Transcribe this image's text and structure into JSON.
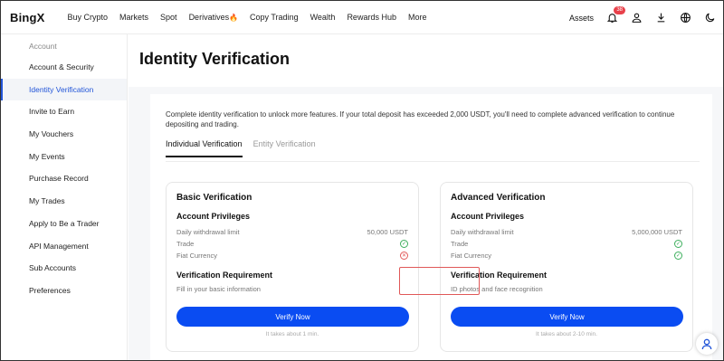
{
  "header": {
    "logo": "BingX",
    "nav": [
      "Buy Crypto",
      "Markets",
      "Spot",
      "Derivatives",
      "Copy Trading",
      "Wealth",
      "Rewards Hub",
      "More"
    ],
    "assets": "Assets",
    "notification_count": "38"
  },
  "sidebar": {
    "heading": "Account",
    "items": [
      {
        "label": "Account & Security"
      },
      {
        "label": "Identity Verification"
      },
      {
        "label": "Invite to Earn"
      },
      {
        "label": "My Vouchers"
      },
      {
        "label": "My Events"
      },
      {
        "label": "Purchase Record"
      },
      {
        "label": "My Trades"
      },
      {
        "label": "Apply to Be a Trader"
      },
      {
        "label": "API Management"
      },
      {
        "label": "Sub Accounts"
      },
      {
        "label": "Preferences"
      }
    ]
  },
  "main": {
    "title": "Identity Verification",
    "notice": "Complete identity verification to unlock more features. If your total deposit has exceeded 2,000 USDT, you'll need to complete advanced verification to continue depositing and trading.",
    "tabs": [
      {
        "label": "Individual Verification"
      },
      {
        "label": "Entity Verification"
      }
    ],
    "basic": {
      "title": "Basic Verification",
      "privileges_title": "Account Privileges",
      "withdrawal_label": "Daily withdrawal limit",
      "withdrawal_value": "50,000 USDT",
      "trade_label": "Trade",
      "fiat_label": "Fiat Currency",
      "req_title": "Verification Requirement",
      "req_text": "Fill in your basic information",
      "button": "Verify Now",
      "takes": "It takes about 1 min."
    },
    "advanced": {
      "title": "Advanced Verification",
      "privileges_title": "Account Privileges",
      "withdrawal_label": "Daily withdrawal limit",
      "withdrawal_value": "5,000,000 USDT",
      "trade_label": "Trade",
      "fiat_label": "Fiat Currency",
      "req_title": "Verification Requirement",
      "req_text": "ID photos and face recognition",
      "button": "Verify Now",
      "takes": "It takes about 2-10 min."
    }
  },
  "colors": {
    "accent": "#0a4cf2",
    "active_sidebar": "#2255d8",
    "highlight": "#e05858"
  }
}
